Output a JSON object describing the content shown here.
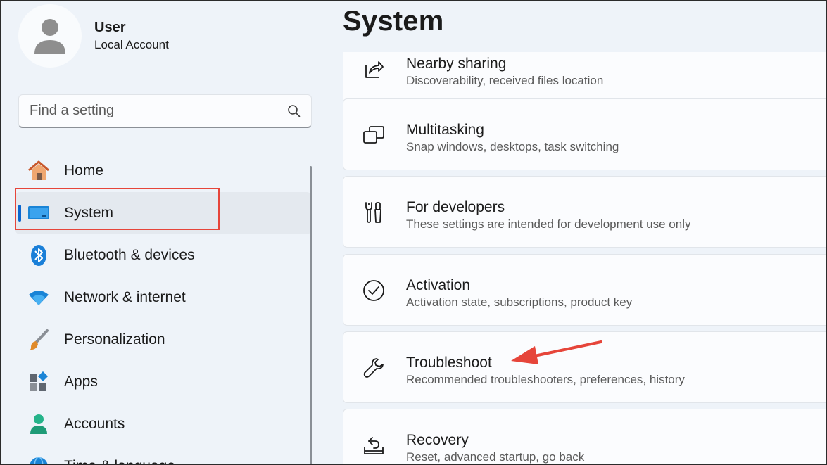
{
  "profile": {
    "name": "User",
    "account_type": "Local Account"
  },
  "search": {
    "placeholder": "Find a setting"
  },
  "sidebar": {
    "items": [
      {
        "label": "Home",
        "icon": "home-icon"
      },
      {
        "label": "System",
        "icon": "system-monitor-icon",
        "active": true
      },
      {
        "label": "Bluetooth & devices",
        "icon": "bluetooth-icon"
      },
      {
        "label": "Network & internet",
        "icon": "wifi-icon"
      },
      {
        "label": "Personalization",
        "icon": "paintbrush-icon"
      },
      {
        "label": "Apps",
        "icon": "apps-icon"
      },
      {
        "label": "Accounts",
        "icon": "accounts-icon"
      },
      {
        "label": "Time & language",
        "icon": "globe-icon"
      }
    ]
  },
  "main": {
    "title": "System",
    "cards": [
      {
        "title": "Nearby sharing",
        "subtitle": "Discoverability, received files location",
        "icon": "share-icon"
      },
      {
        "title": "Multitasking",
        "subtitle": "Snap windows, desktops, task switching",
        "icon": "multitasking-icon"
      },
      {
        "title": "For developers",
        "subtitle": "These settings are intended for development use only",
        "icon": "developer-tools-icon"
      },
      {
        "title": "Activation",
        "subtitle": "Activation state, subscriptions, product key",
        "icon": "checkmark-circle-icon"
      },
      {
        "title": "Troubleshoot",
        "subtitle": "Recommended troubleshooters, preferences, history",
        "icon": "wrench-icon"
      },
      {
        "title": "Recovery",
        "subtitle": "Reset, advanced startup, go back",
        "icon": "recovery-icon"
      }
    ]
  },
  "colors": {
    "accent": "#0b66cf",
    "annotation": "#e6453a"
  }
}
